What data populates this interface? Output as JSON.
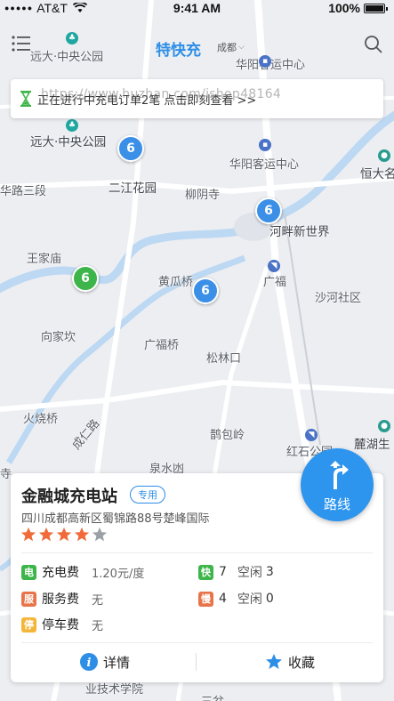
{
  "status_bar": {
    "carrier": "AT&T",
    "time": "9:41 AM",
    "battery": "100%"
  },
  "header": {
    "title": "特快充",
    "city": "成都"
  },
  "banner": {
    "text": "正在进行中充电订单2笔 点击即刻查看 >>",
    "watermark": "https://www.huzhan.com/ishop48164"
  },
  "map": {
    "labels": {
      "top_park_1": "远大·中央公园",
      "top_park_2": "远大·中央公园",
      "top_right_1": "华阳客运中心",
      "top_right_2": "华阳客运中心",
      "hengda": "恒大名",
      "erjiang": "二江花园",
      "huaqiao_road": "华路三段",
      "liuyin": "柳阴寺",
      "hepan": "河畔新世界",
      "wangjiamiao": "王家庙",
      "huanggua": "黄瓜桥",
      "guangfu": "广福",
      "shahe": "沙河社区",
      "xiangjia": "向家坎",
      "guangfuqiao": "广福桥",
      "songlin": "松林口",
      "huoshao": "火烧桥",
      "chengren_road": "成仁路",
      "quanshui": "泉水凼",
      "hongshi": "红石公园",
      "luhu": "麓湖生",
      "hebao": "鹊包岭",
      "bottom_left": "寺",
      "bottom_tech": "业技术学院",
      "bottom_right": "三盆"
    },
    "pins": [
      {
        "count": "6",
        "color": "blue"
      },
      {
        "count": "6",
        "color": "blue"
      },
      {
        "count": "6",
        "color": "green"
      },
      {
        "count": "6",
        "color": "blue"
      }
    ]
  },
  "station": {
    "name": "金融城充电站",
    "tag": "专用",
    "address": "四川成都高新区蜀锦路88号楚峰国际",
    "rating": 4,
    "rating_max": 5,
    "fees": {
      "charging_badge": "电",
      "charging_label": "充电费",
      "charging_value": "1.20元/度",
      "service_badge": "服",
      "service_label": "服务费",
      "service_value": "无",
      "parking_badge": "停",
      "parking_label": "停车费",
      "parking_value": "无"
    },
    "slots": {
      "fast_badge": "快",
      "fast_count": "7",
      "fast_idle_label": "空闲",
      "fast_idle": "3",
      "slow_badge": "慢",
      "slow_count": "4",
      "slow_idle_label": "空闲",
      "slow_idle": "0"
    },
    "details_label": "详情",
    "favorite_label": "收藏"
  },
  "route_button": {
    "label": "路线"
  },
  "colors": {
    "accent": "#2d8ee6",
    "route_button": "#2d95ee",
    "pin_blue": "#3b8fe6",
    "pin_green": "#3eb54a",
    "star": "#f06a3a",
    "star_empty": "#9aa0a6"
  }
}
